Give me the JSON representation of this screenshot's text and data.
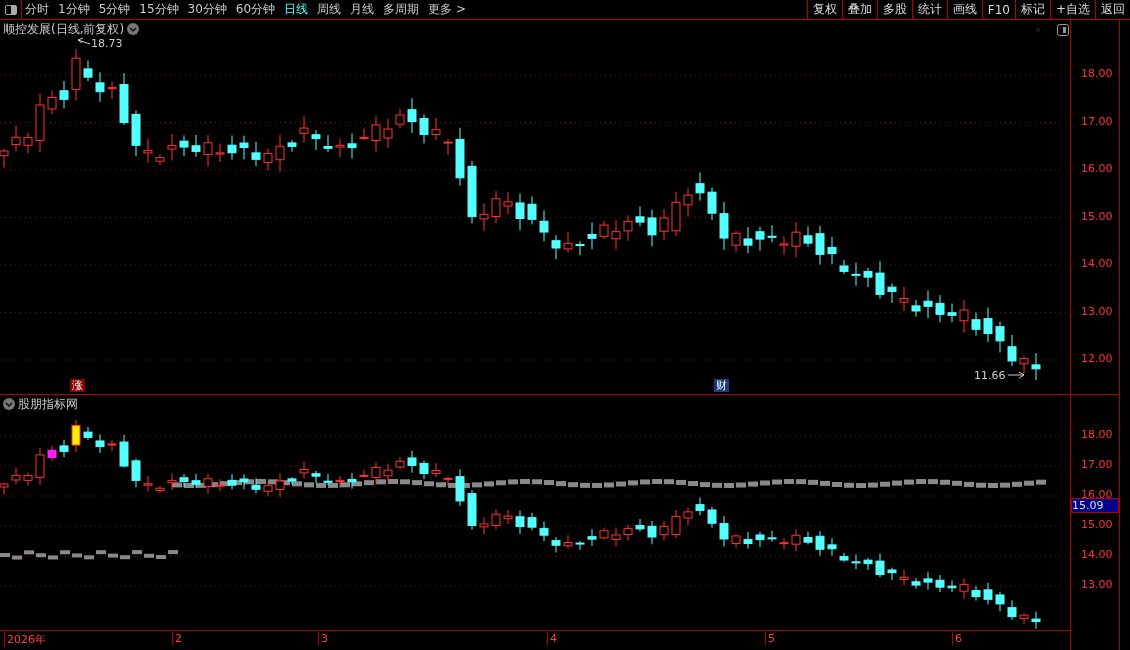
{
  "toolbar": {
    "tabs": [
      {
        "label": "分时",
        "selected": false
      },
      {
        "label": "1分钟",
        "selected": false
      },
      {
        "label": "5分钟",
        "selected": false
      },
      {
        "label": "15分钟",
        "selected": false
      },
      {
        "label": "30分钟",
        "selected": false
      },
      {
        "label": "60分钟",
        "selected": false
      },
      {
        "label": "日线",
        "selected": true
      },
      {
        "label": "周线",
        "selected": false
      },
      {
        "label": "月线",
        "selected": false
      },
      {
        "label": "多周期",
        "selected": false
      },
      {
        "label": "更多 >",
        "selected": false
      }
    ],
    "buttons": [
      "复权",
      "叠加",
      "多股",
      "统计",
      "画线",
      "F10",
      "标记",
      "+自选",
      "返回"
    ]
  },
  "main_chart": {
    "title": "顺控发展(日线,前复权)",
    "high_label": "18.73",
    "low_label": "11.66",
    "price_axis": [
      "18.00",
      "17.00",
      "16.00",
      "15.00",
      "14.00",
      "13.00",
      "12.00"
    ],
    "markers": [
      {
        "label": "涨",
        "kind": "limit_up"
      },
      {
        "label": "财",
        "kind": "finance"
      }
    ]
  },
  "indicator_chart": {
    "title": "股朋指标网",
    "price_axis": [
      "18.00",
      "17.00",
      "16.00",
      "15.00",
      "14.00",
      "13.00"
    ],
    "current_price": "15.09"
  },
  "date_axis": [
    "2026年",
    "2",
    "3",
    "4",
    "5",
    "6"
  ]
}
